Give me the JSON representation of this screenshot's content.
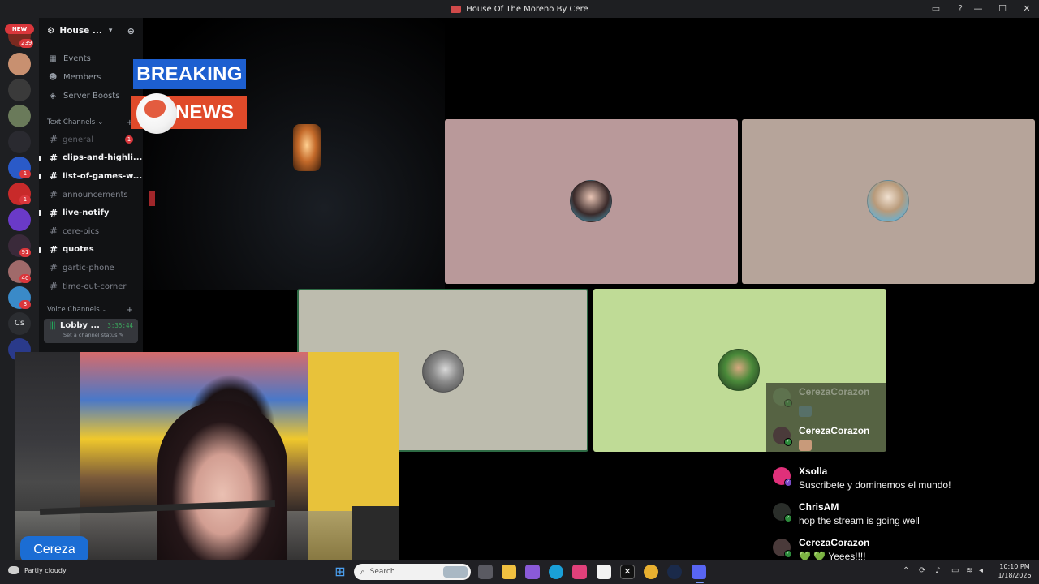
{
  "window": {
    "title": "House Of The Moreno By Cere",
    "inbox_icon": "inbox-icon",
    "help_icon": "help-icon",
    "controls": [
      "—",
      "☐",
      "✕"
    ]
  },
  "rail": {
    "new_label": "NEW",
    "badges": [
      "239",
      "1",
      "1",
      "1",
      "91",
      "40",
      "3"
    ],
    "text_server": "Cs"
  },
  "sidebar": {
    "server_name": "House ...",
    "nav": [
      {
        "label": "Events",
        "icon": "calendar-icon"
      },
      {
        "label": "Members",
        "icon": "members-icon"
      },
      {
        "label": "Server Boosts",
        "icon": "boost-icon"
      }
    ],
    "text_category": "Text Channels",
    "channels": [
      {
        "name": "general",
        "state": "dim",
        "mention": "1"
      },
      {
        "name": "clips-and-highli...",
        "state": "unread"
      },
      {
        "name": "list-of-games-w...",
        "state": "unread"
      },
      {
        "name": "announcements",
        "state": "read"
      },
      {
        "name": "live-notify",
        "state": "unread"
      },
      {
        "name": "cere-pics",
        "state": "read"
      },
      {
        "name": "quotes",
        "state": "unread"
      },
      {
        "name": "gartic-phone",
        "state": "read"
      },
      {
        "name": "time-out-corner",
        "state": "read"
      }
    ],
    "voice_category": "Voice Channels",
    "voice_channel": {
      "name": "Lobby ...",
      "timer": "3:35:44",
      "status": "Set a channel status"
    }
  },
  "overlay": {
    "breaking": "BREAKING",
    "news": "NEWS",
    "streamer_name": "Cereza"
  },
  "colors": {
    "tile_1": "#b9999a",
    "tile_2": "#b6a49a",
    "tile_3": "#bdbcae",
    "tile_4": "#bfdb96",
    "breaking_blue": "#1d5fd0",
    "news_orange": "#e04a2a",
    "speaking_green": "#2e6b45"
  },
  "chat": {
    "messages": [
      {
        "user": "CerezaCorazon",
        "text": "",
        "faded": true,
        "emote": true,
        "avatar": "#6f8f63"
      },
      {
        "user": "CerezaCorazon",
        "text": "",
        "faded": false,
        "emote": true,
        "avatar": "#4a3a3a"
      },
      {
        "user": "Xsolla",
        "text": "Suscribete y dominemos el mundo!",
        "faded": false,
        "emote": false,
        "avatar": "#e0307a"
      },
      {
        "user": "ChrisAM",
        "text": "hop the stream is going well",
        "faded": false,
        "emote": false,
        "avatar": "#2a2e2a"
      },
      {
        "user": "CerezaCorazon",
        "text": "💚 💚 Yeees!!!!",
        "faded": false,
        "emote": false,
        "avatar": "#4a3a3a"
      }
    ]
  },
  "taskbar": {
    "weather": "Partly cloudy",
    "search_placeholder": "Search",
    "time": "10:10 PM",
    "date": "1/18/2026"
  }
}
